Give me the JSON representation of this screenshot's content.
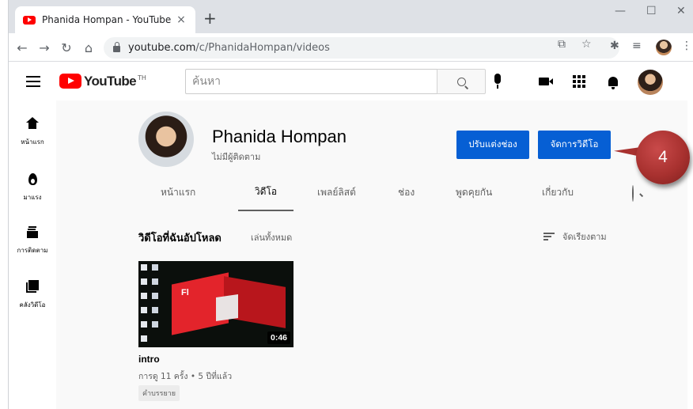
{
  "browser": {
    "tab_title": "Phanida Hompan - YouTube",
    "tab_close": "×",
    "new_tab": "+",
    "url_host": "youtube.com",
    "url_path": "/c/PhanidaHompan/videos",
    "window_minimize": "—",
    "window_maximize": "☐",
    "window_close": "✕"
  },
  "youtube": {
    "logo_text": "YouTube",
    "logo_region": "TH",
    "search_placeholder": "ค้นหา"
  },
  "sidebar": {
    "items": [
      {
        "label": "หน้าแรก",
        "icon": "home-icon"
      },
      {
        "label": "มาแรง",
        "icon": "fire-icon"
      },
      {
        "label": "การติดตาม",
        "icon": "subscriptions-icon"
      },
      {
        "label": "คลังวิดีโอ",
        "icon": "library-icon"
      }
    ]
  },
  "channel": {
    "name": "Phanida Hompan",
    "subscribers": "ไม่มีผู้ติดตาม",
    "customize_button": "ปรับแต่งช่อง",
    "manage_button": "จัดการวิดีโอ",
    "tabs": [
      {
        "label": "หน้าแรก",
        "active": false
      },
      {
        "label": "วิดีโอ",
        "active": true
      },
      {
        "label": "เพลย์ลิสต์",
        "active": false
      },
      {
        "label": "ช่อง",
        "active": false
      },
      {
        "label": "พูดคุยกัน",
        "active": false
      },
      {
        "label": "เกี่ยวกับ",
        "active": false
      }
    ]
  },
  "uploads": {
    "section_title": "วิดีโอที่ฉันอัปโหลด",
    "play_all": "เล่นทั้งหมด",
    "sort_label": "จัดเรียงตาม",
    "videos": [
      {
        "title": "intro",
        "duration": "0:46",
        "meta": "การดู 11 ครั้ง • 5 ปีที่แล้ว",
        "badge": "คำบรรยาย",
        "thumb_text": "Fl"
      }
    ]
  },
  "annotation": {
    "step_number": "4"
  },
  "colors": {
    "accent_blue": "#065fd4",
    "youtube_red": "#ff0000",
    "callout_red": "#a8312f"
  }
}
